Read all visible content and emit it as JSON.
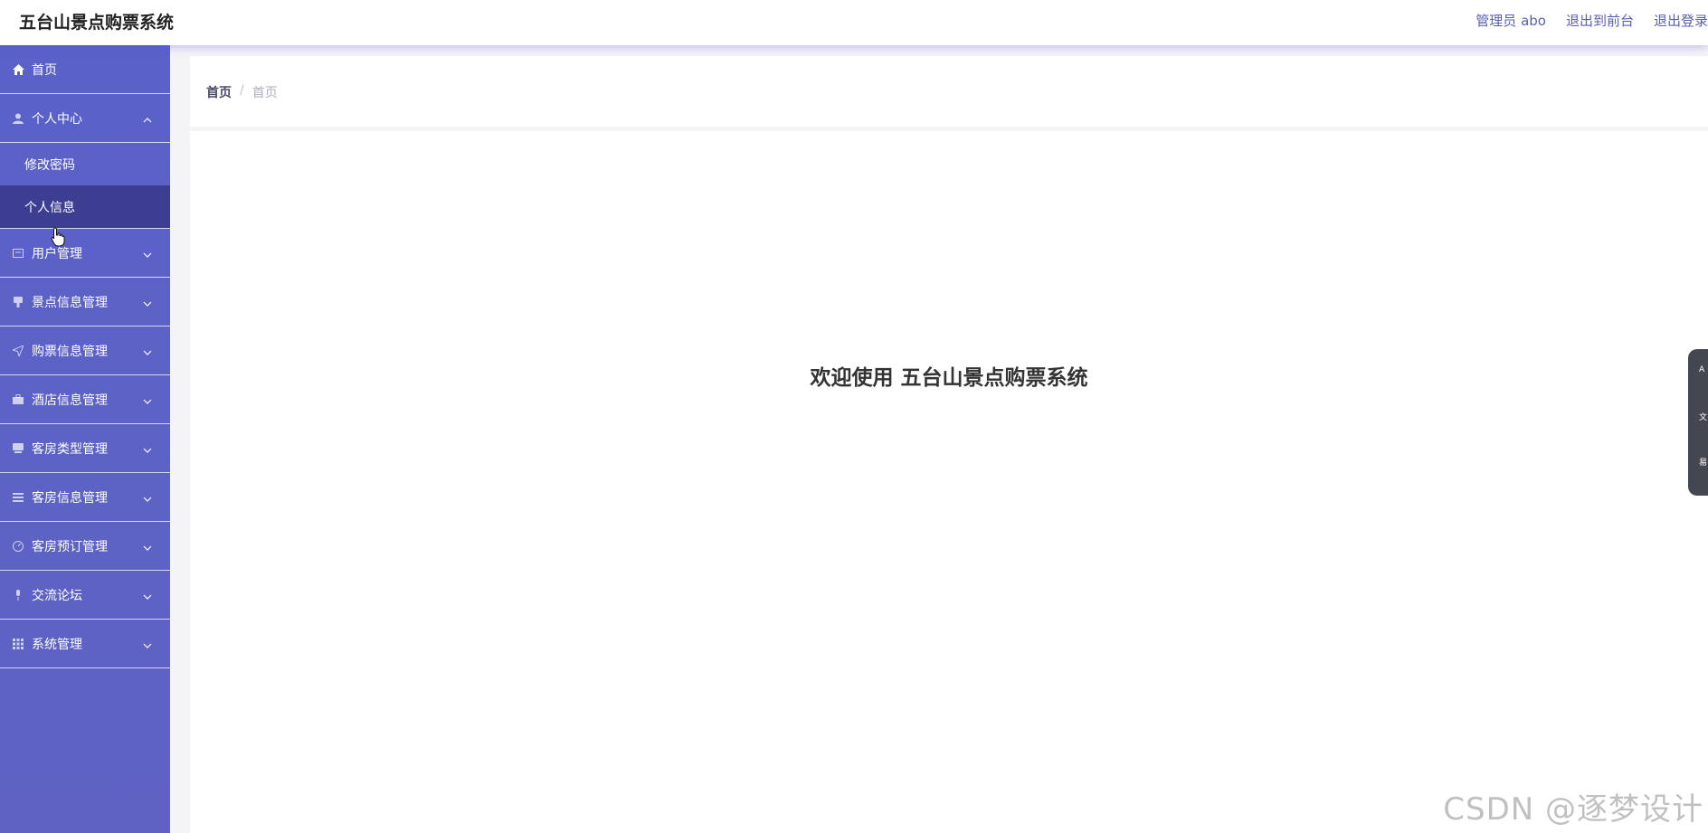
{
  "header": {
    "brand": "五台山景点购票系统",
    "user": "管理员 abo",
    "to_front": "退出到前台",
    "logout": "退出登录"
  },
  "sidebar": {
    "home": "首页",
    "personal_center": "个人中心",
    "change_password": "修改密码",
    "personal_info": "个人信息",
    "items": [
      {
        "label": "用户管理",
        "icon": "user-card-icon"
      },
      {
        "label": "景点信息管理",
        "icon": "attraction-icon"
      },
      {
        "label": "购票信息管理",
        "icon": "send-icon"
      },
      {
        "label": "酒店信息管理",
        "icon": "briefcase-icon"
      },
      {
        "label": "客房类型管理",
        "icon": "room-type-icon"
      },
      {
        "label": "客房信息管理",
        "icon": "list-icon"
      },
      {
        "label": "客房预订管理",
        "icon": "gauge-icon"
      },
      {
        "label": "交流论坛",
        "icon": "microphone-icon"
      },
      {
        "label": "系统管理",
        "icon": "grid-icon"
      }
    ]
  },
  "breadcrumb": {
    "first": "首页",
    "separator": "/",
    "current": "首页"
  },
  "main": {
    "welcome": "欢迎使用 五台山景点购票系统"
  },
  "float_panel": [
    "A",
    "文",
    "易"
  ],
  "watermark": "CSDN @逐梦设计"
}
